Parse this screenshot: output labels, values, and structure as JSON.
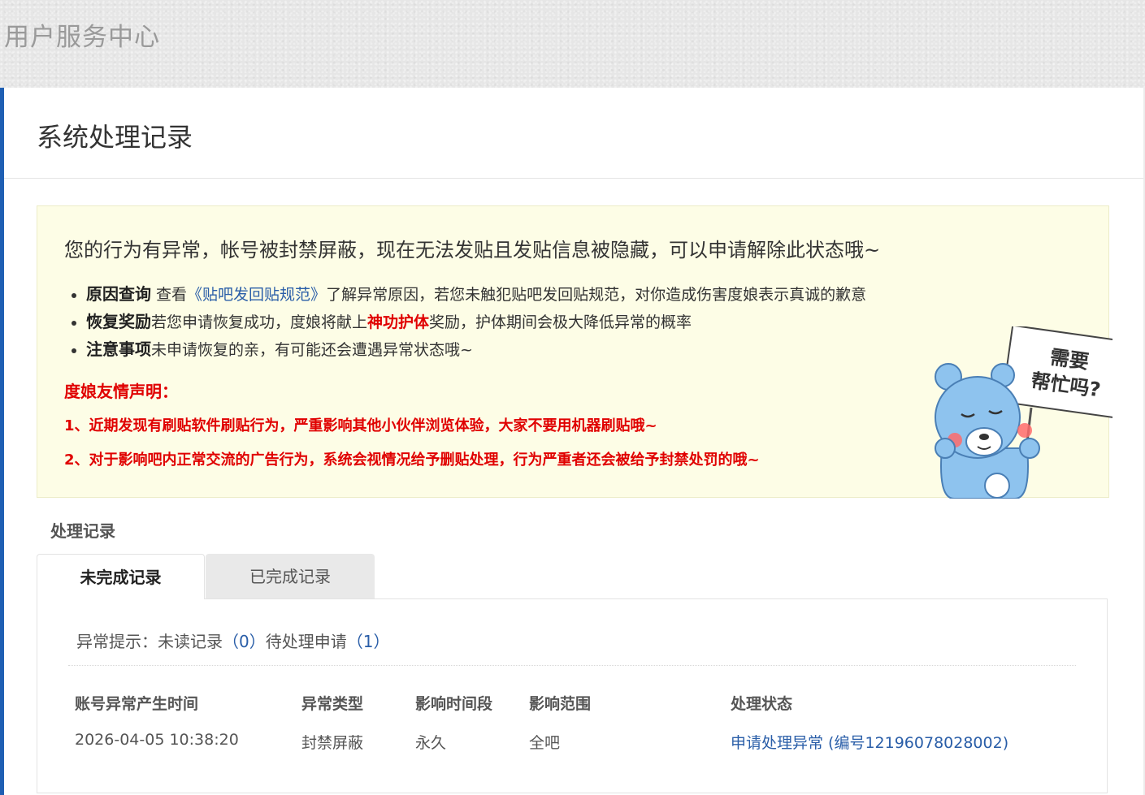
{
  "header": {
    "site_title": "用户服务中心"
  },
  "page": {
    "title": "系统处理记录"
  },
  "notice": {
    "lead": "您的行为有异常，帐号被封禁屏蔽，现在无法发贴且发贴信息被隐藏，可以申请解除此状态哦~",
    "items": [
      {
        "label": "原因查询",
        "pre": " 查看",
        "link": "《贴吧发回贴规范》",
        "post": "了解异常原因，若您未触犯贴吧发回贴规范，对你造成伤害度娘表示真诚的歉意"
      },
      {
        "label": "恢复奖励",
        "pre": "若您申请恢复成功，度娘将献上",
        "highlight": "神功护体",
        "post": "奖励，护体期间会极大降低异常的概率"
      },
      {
        "label": "注意事项",
        "text": "未申请恢复的亲，有可能还会遭遇异常状态哦~"
      }
    ],
    "declaration_title": "度娘友情声明：",
    "declarations": [
      "1、近期发现有刷贴软件刷贴行为，严重影响其他小伙伴浏览体验，大家不要用机器刷贴哦~",
      "2、对于影响吧内正常交流的广告行为，系统会视情况给予删贴处理，行为严重者还会被给予封禁处罚的哦~"
    ],
    "mascot_sign": [
      "需要",
      "帮忙吗?"
    ]
  },
  "records": {
    "title": "处理记录",
    "tabs": [
      {
        "label": "未完成记录",
        "active": true
      },
      {
        "label": "已完成记录",
        "active": false
      }
    ],
    "hint": {
      "prefix": "异常提示：",
      "unread_label": "未读记录",
      "unread_count": "（0）",
      "pending_label": "待处理申请",
      "pending_count": "（1）"
    },
    "columns": [
      "账号异常产生时间",
      "异常类型",
      "影响时间段",
      "影响范围",
      "处理状态"
    ],
    "rows": [
      [
        "2026-04-05 10:38:20",
        "封禁屏蔽",
        "永久",
        "全吧",
        "申请处理异常 (编号12196078028002)"
      ]
    ]
  },
  "colors": {
    "accent": "#1f5fb3",
    "link": "#2a5ea8",
    "warning": "#e00000",
    "notice_bg": "#fdfde6"
  }
}
